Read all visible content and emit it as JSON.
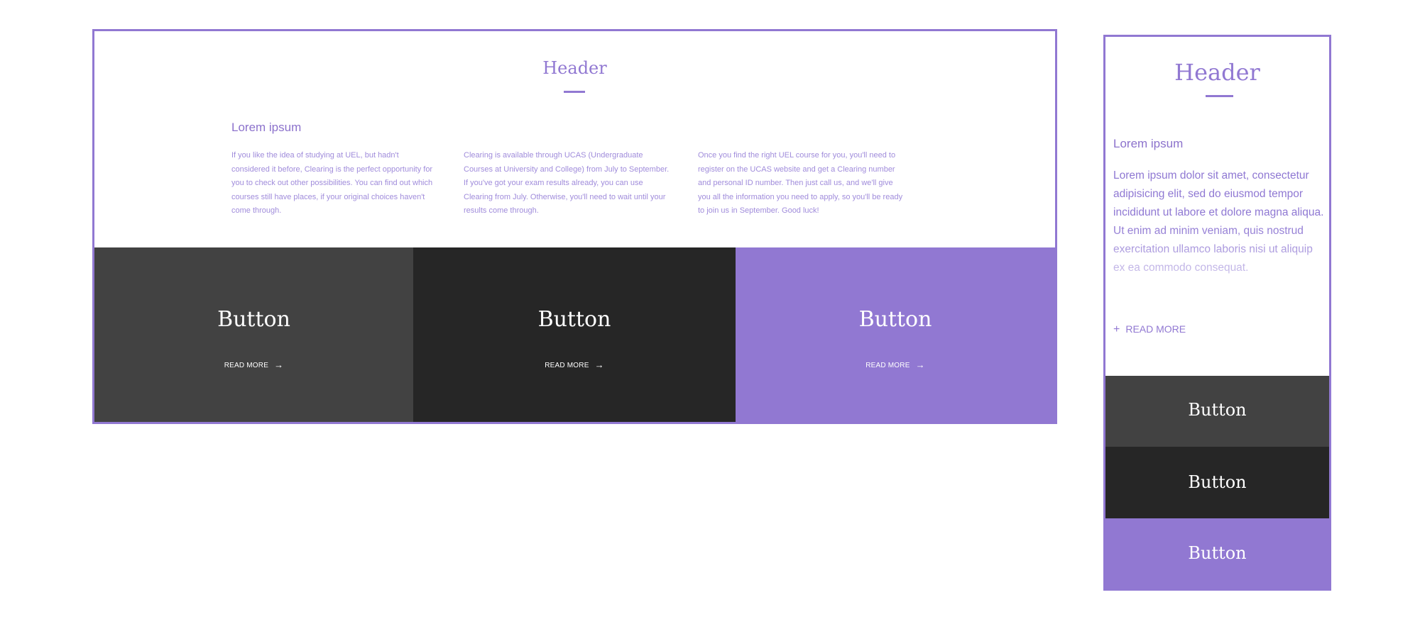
{
  "desktop": {
    "header": "Header",
    "subtitle": "Lorem ipsum",
    "columns": [
      "If you like the idea of studying at UEL, but hadn't considered it before, Clearing is the perfect opportunity for you to check out other possibilities. You can find out which courses still have places, if your original choices haven't come through.",
      "Clearing is available through UCAS (Undergraduate Courses at University and College) from July to September. If you've got your exam results already, you can use Clearing from July. Otherwise, you'll need to wait until your results come through.",
      "Once you find the right UEL course for you, you'll need to register on the UCAS website and get a Clearing number and personal ID number. Then just call us, and we'll give you all the information you need to apply, so you'll be ready to join us in September. Good luck!"
    ],
    "buttons": [
      {
        "label": "Button",
        "more": "READ MORE",
        "color": "#424242"
      },
      {
        "label": "Button",
        "more": "READ MORE",
        "color": "#262626"
      },
      {
        "label": "Button",
        "more": "READ MORE",
        "color": "#9178d2"
      }
    ]
  },
  "mobile": {
    "header": "Header",
    "subtitle": "Lorem ipsum",
    "body": "Lorem ipsum dolor sit amet, consectetur adipisicing elit, sed do eiusmod tempor incididunt ut labore et dolore magna aliqua. Ut enim ad minim veniam, quis nostrud exercitation ullamco laboris nisi ut aliquip ex ea commodo consequat.",
    "read_more": "READ MORE",
    "buttons": [
      "Button",
      "Button",
      "Button"
    ]
  },
  "colors": {
    "accent": "#9178d2",
    "button_dark_gray": "#424242",
    "button_black": "#262626"
  },
  "icons": {
    "read_more_arrow": "arrow-right-icon",
    "read_more_plus": "plus-icon"
  }
}
